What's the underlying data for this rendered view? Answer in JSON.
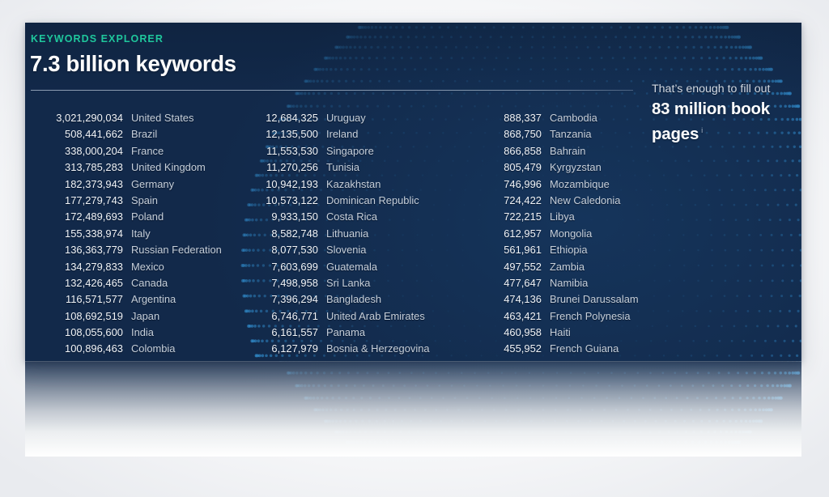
{
  "panel": {
    "eyebrow": "KEYWORDS EXPLORER",
    "headline": "7.3 billion keywords",
    "accent_color": "#1fc79c",
    "background_color": "#12294a",
    "text_color": "#ffffff"
  },
  "callout": {
    "lead": "That’s enough to fill out",
    "emphasis": "83 million book pages",
    "info_marker": "i"
  },
  "columns": [
    {
      "id": "column-1",
      "rows": [
        {
          "count": "3,021,290,034",
          "country": "United States"
        },
        {
          "count": "508,441,662",
          "country": "Brazil"
        },
        {
          "count": "338,000,204",
          "country": "France"
        },
        {
          "count": "313,785,283",
          "country": "United Kingdom"
        },
        {
          "count": "182,373,943",
          "country": "Germany"
        },
        {
          "count": "177,279,743",
          "country": "Spain"
        },
        {
          "count": "172,489,693",
          "country": "Poland"
        },
        {
          "count": "155,338,974",
          "country": "Italy"
        },
        {
          "count": "136,363,779",
          "country": "Russian Federation"
        },
        {
          "count": "134,279,833",
          "country": "Mexico"
        },
        {
          "count": "132,426,465",
          "country": "Canada"
        },
        {
          "count": "116,571,577",
          "country": "Argentina"
        },
        {
          "count": "108,692,519",
          "country": "Japan"
        },
        {
          "count": "108,055,600",
          "country": "India"
        },
        {
          "count": "100,896,463",
          "country": "Colombia"
        }
      ]
    },
    {
      "id": "column-2",
      "rows": [
        {
          "count": "12,684,325",
          "country": "Uruguay"
        },
        {
          "count": "12,135,500",
          "country": "Ireland"
        },
        {
          "count": "11,553,530",
          "country": "Singapore"
        },
        {
          "count": "11,270,256",
          "country": "Tunisia"
        },
        {
          "count": "10,942,193",
          "country": "Kazakhstan"
        },
        {
          "count": "10,573,122",
          "country": "Dominican Republic"
        },
        {
          "count": "9,933,150",
          "country": "Costa Rica"
        },
        {
          "count": "8,582,748",
          "country": "Lithuania"
        },
        {
          "count": "8,077,530",
          "country": "Slovenia"
        },
        {
          "count": "7,603,699",
          "country": "Guatemala"
        },
        {
          "count": "7,498,958",
          "country": "Sri Lanka"
        },
        {
          "count": "7,396,294",
          "country": "Bangladesh"
        },
        {
          "count": "6,746,771",
          "country": "United Arab Emirates"
        },
        {
          "count": "6,161,557",
          "country": "Panama"
        },
        {
          "count": "6,127,979",
          "country": "Bosnia & Herzegovina"
        }
      ]
    },
    {
      "id": "column-3",
      "rows": [
        {
          "count": "888,337",
          "country": "Cambodia"
        },
        {
          "count": "868,750",
          "country": "Tanzania"
        },
        {
          "count": "866,858",
          "country": "Bahrain"
        },
        {
          "count": "805,479",
          "country": "Kyrgyzstan"
        },
        {
          "count": "746,996",
          "country": "Mozambique"
        },
        {
          "count": "724,422",
          "country": "New Caledonia"
        },
        {
          "count": "722,215",
          "country": "Libya"
        },
        {
          "count": "612,957",
          "country": "Mongolia"
        },
        {
          "count": "561,961",
          "country": "Ethiopia"
        },
        {
          "count": "497,552",
          "country": "Zambia"
        },
        {
          "count": "477,647",
          "country": "Namibia"
        },
        {
          "count": "474,136",
          "country": "Brunei Darussalam"
        },
        {
          "count": "463,421",
          "country": "French Polynesia"
        },
        {
          "count": "460,958",
          "country": "Haiti"
        },
        {
          "count": "455,952",
          "country": "French Guiana"
        }
      ]
    }
  ],
  "decoration": {
    "globe_icon": "dotted-globe-hemisphere",
    "dot_color": "#2f86c4"
  }
}
